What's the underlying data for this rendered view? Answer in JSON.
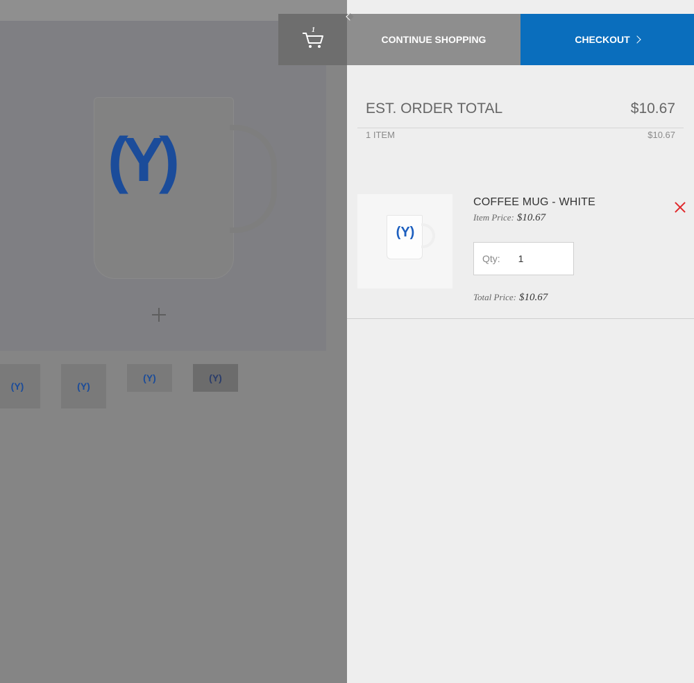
{
  "header": {
    "cart_count": "1",
    "continue_label": "CONTINUE SHOPPING",
    "checkout_label": "CHECKOUT"
  },
  "summary": {
    "title": "EST. ORDER TOTAL",
    "total": "$10.67",
    "items_label": "1 ITEM",
    "items_total": "$10.67"
  },
  "cart_item": {
    "name": "COFFEE MUG - WHITE",
    "item_price_label": "Item Price:",
    "item_price": "$10.67",
    "qty_label": "Qty:",
    "qty_value": "1",
    "total_price_label": "Total Price:",
    "total_price": "$10.67"
  },
  "product": {
    "logo_text": "(Y)"
  },
  "icons": {
    "cart": "cart-icon",
    "remove": "close-icon",
    "zoom": "plus-icon"
  },
  "colors": {
    "checkout": "#0a6ebd",
    "remove": "#e0282b",
    "logo": "#1d5fbf"
  }
}
